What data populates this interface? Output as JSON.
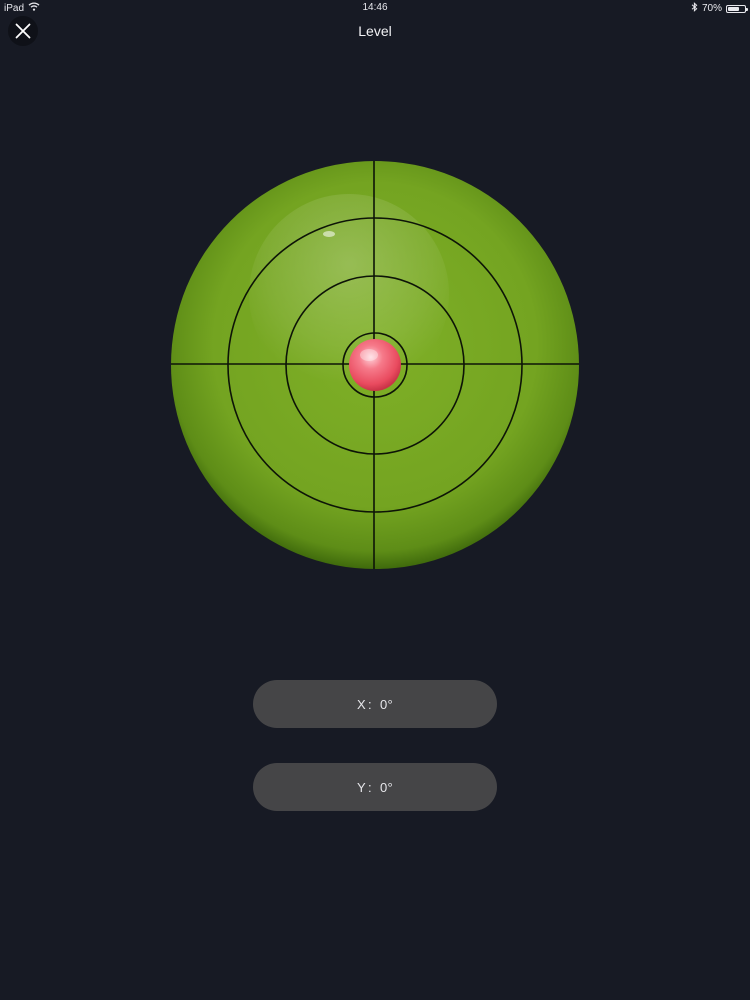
{
  "status_bar": {
    "device": "iPad",
    "time": "14:46",
    "battery": "70%",
    "battery_level": 0.7,
    "icons": [
      "wifi-icon",
      "bluetooth-icon",
      "battery-icon"
    ]
  },
  "header": {
    "title": "Level",
    "close_icon": "close-icon"
  },
  "level": {
    "x_tilt_deg": 0,
    "y_tilt_deg": 0,
    "colors": {
      "background": "#171a24",
      "vial_green": "#74a523",
      "vial_dark": "#4f7d12",
      "bubble": "#f2596c",
      "lines": "#0d1407"
    }
  },
  "readouts": {
    "x_label": "X",
    "x_value": "0°",
    "y_label": "Y",
    "y_value": "0°",
    "separator": ":"
  }
}
